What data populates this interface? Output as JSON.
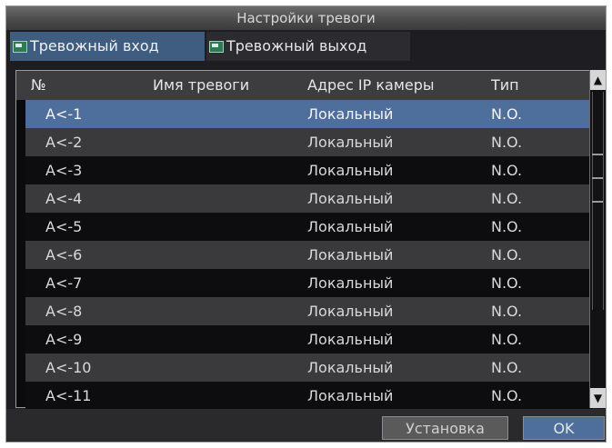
{
  "window": {
    "title": "Настройки тревоги"
  },
  "tabs": [
    {
      "label": "Тревожный вход",
      "icon": "alarm-input-icon"
    },
    {
      "label": "Тревожный выход",
      "icon": "alarm-output-icon"
    }
  ],
  "table": {
    "columns": [
      "№",
      "Имя тревоги",
      "Адрес IP камеры",
      "Тип"
    ],
    "rows": [
      {
        "num": "A<-1",
        "name": "",
        "ip": "Локальный",
        "type": "N.O."
      },
      {
        "num": "A<-2",
        "name": "",
        "ip": "Локальный",
        "type": "N.O."
      },
      {
        "num": "A<-3",
        "name": "",
        "ip": "Локальный",
        "type": "N.O."
      },
      {
        "num": "A<-4",
        "name": "",
        "ip": "Локальный",
        "type": "N.O."
      },
      {
        "num": "A<-5",
        "name": "",
        "ip": "Локальный",
        "type": "N.O."
      },
      {
        "num": "A<-6",
        "name": "",
        "ip": "Локальный",
        "type": "N.O."
      },
      {
        "num": "A<-7",
        "name": "",
        "ip": "Локальный",
        "type": "N.O."
      },
      {
        "num": "A<-8",
        "name": "",
        "ip": "Локальный",
        "type": "N.O."
      },
      {
        "num": "A<-9",
        "name": "",
        "ip": "Локальный",
        "type": "N.O."
      },
      {
        "num": "A<-10",
        "name": "",
        "ip": "Локальный",
        "type": "N.O."
      },
      {
        "num": "A<-11",
        "name": "",
        "ip": "Локальный",
        "type": "N.O."
      }
    ],
    "selected_row": 0
  },
  "scrollbar": {
    "up_icon": "chevron-up-icon",
    "down_icon": "chevron-down-icon"
  },
  "footer": {
    "setup_label": "Установка",
    "ok_label": "OK"
  },
  "colors": {
    "accent": "#4e6e9c",
    "background": "#1e1e22"
  }
}
